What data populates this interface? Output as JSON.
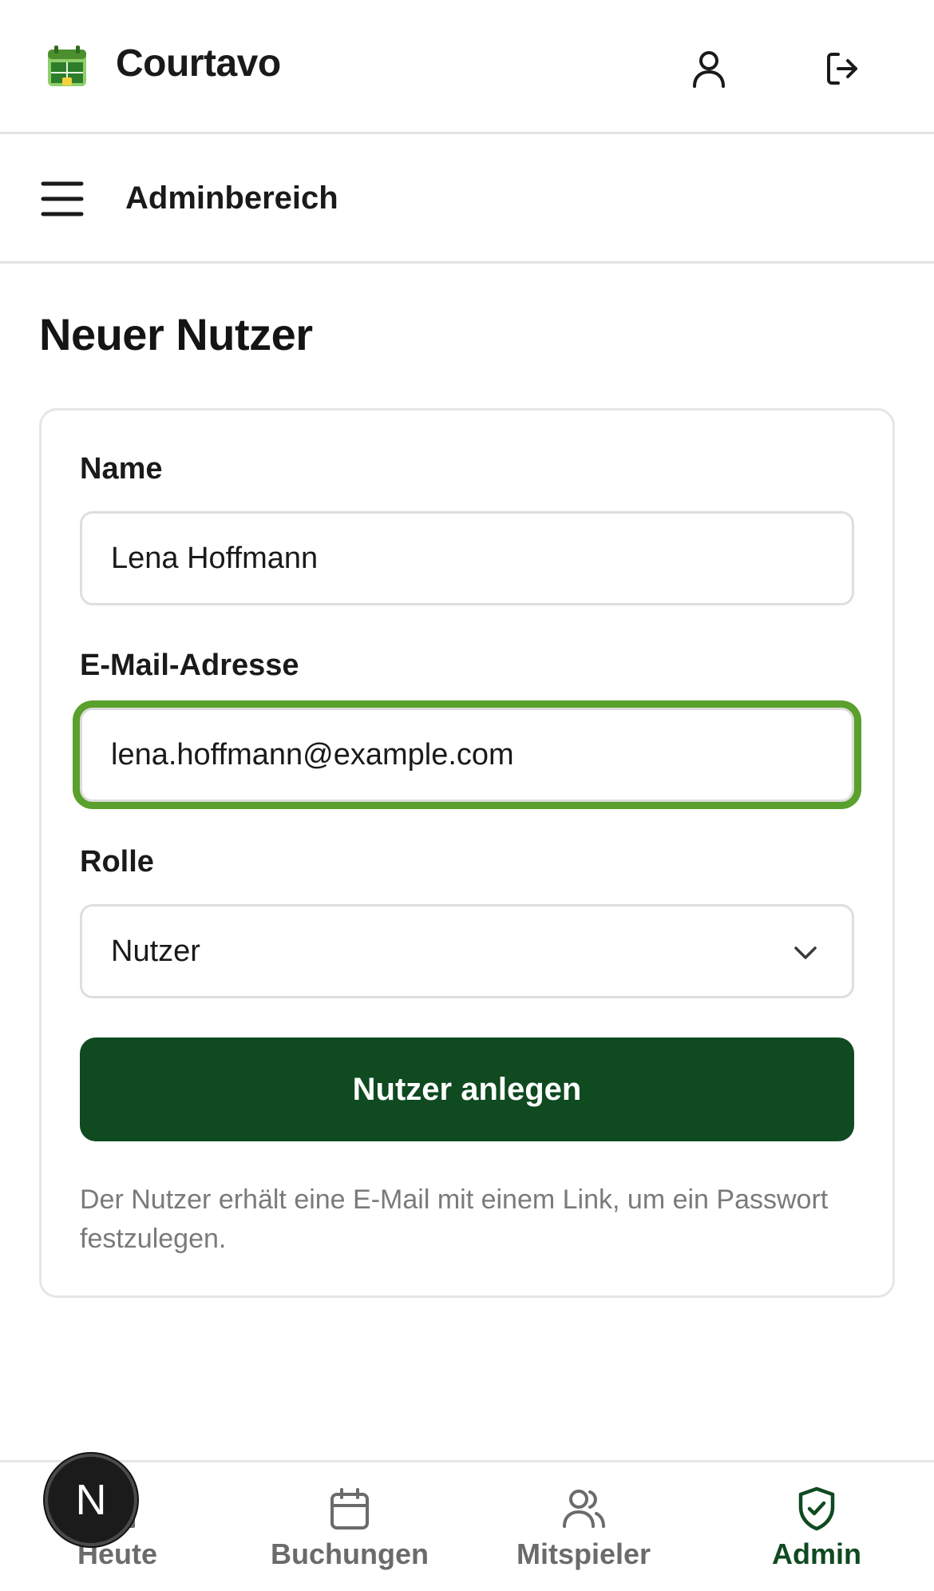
{
  "app": {
    "title": "Courtavo",
    "logo_icon": "court-calendar-logo-icon",
    "profile_icon": "user-icon",
    "logout_icon": "logout-icon"
  },
  "section": {
    "menu_icon": "hamburger-menu-icon",
    "title": "Adminbereich"
  },
  "page": {
    "heading": "Neuer Nutzer"
  },
  "form": {
    "name_label": "Name",
    "name_value": "Lena Hoffmann",
    "email_label": "E-Mail-Adresse",
    "email_value": "lena.hoffmann@example.com",
    "role_label": "Rolle",
    "role_value": "Nutzer",
    "submit_label": "Nutzer anlegen",
    "hint": "Der Nutzer erhält eine E-Mail mit einem Link, um ein Passwort festzulegen."
  },
  "nav": {
    "items": [
      {
        "label": "Heute",
        "icon": "home-icon",
        "active": false
      },
      {
        "label": "Buchungen",
        "icon": "calendar-icon",
        "active": false
      },
      {
        "label": "Mitspieler",
        "icon": "users-icon",
        "active": false
      },
      {
        "label": "Admin",
        "icon": "shield-check-icon",
        "active": true
      }
    ]
  },
  "dev_badge": {
    "letter": "N"
  },
  "colors": {
    "primary": "#0f4a21",
    "focus_ring": "#5aa02c",
    "border": "#e3e3e3",
    "muted_text": "#7a7a7a"
  }
}
